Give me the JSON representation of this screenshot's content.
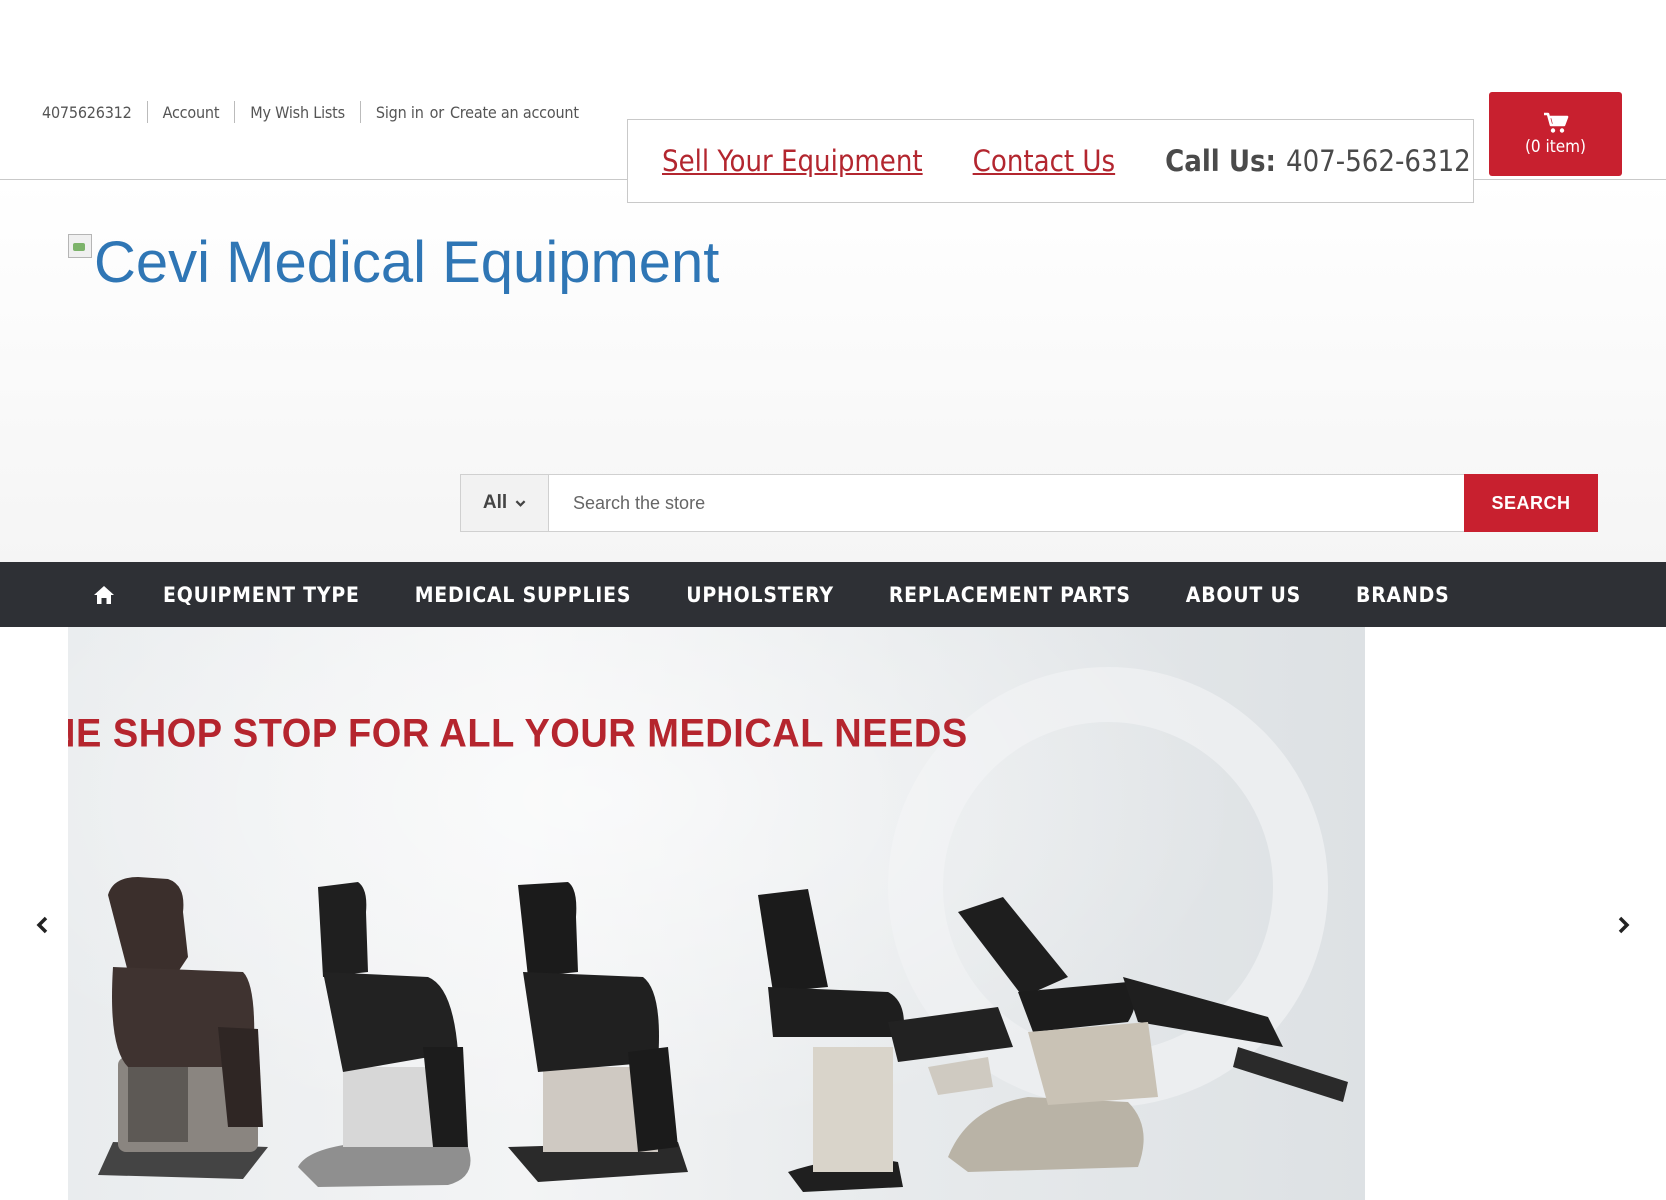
{
  "utility_bar": {
    "phone": "4075626312",
    "account": "Account",
    "wishlists": "My Wish Lists",
    "sign_in": "Sign in",
    "or": "or",
    "create_account": "Create an account"
  },
  "callbox": {
    "sell": "Sell Your Equipment",
    "contact": "Contact Us",
    "call_label": "Call Us:",
    "call_number": "407-562-6312"
  },
  "cart": {
    "icon": "cart-icon",
    "label": "(0 item)"
  },
  "logo": {
    "alt_text": "Cevi Medical Equipment"
  },
  "search": {
    "scope": "All",
    "placeholder": "Search the store",
    "button": "SEARCH"
  },
  "nav": {
    "home_icon": "home-icon",
    "items": [
      {
        "label": "EQUIPMENT TYPE"
      },
      {
        "label": "MEDICAL SUPPLIES"
      },
      {
        "label": "UPHOLSTERY"
      },
      {
        "label": "REPLACEMENT PARTS"
      },
      {
        "label": "ABOUT US"
      },
      {
        "label": "BRANDS"
      }
    ]
  },
  "hero": {
    "headline": "NE SHOP STOP FOR ALL YOUR MEDICAL NEEDS",
    "prev_icon": "chevron-left-icon",
    "next_icon": "chevron-right-icon"
  },
  "colors": {
    "brand_red": "#c8202f",
    "nav_dark": "#2e3035",
    "logo_blue": "#2f76b5",
    "link_red": "#b3262f"
  }
}
